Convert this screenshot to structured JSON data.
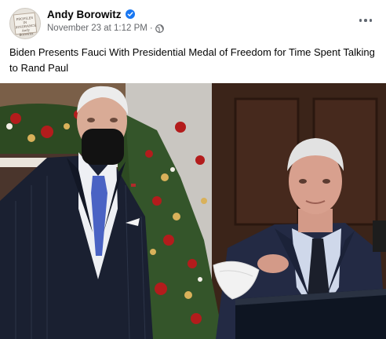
{
  "post": {
    "author": "Andy Borowitz",
    "timestamp": "November 23 at 1:12 PM",
    "separator": "·",
    "caption": "Biden Presents Fauci With Presidential Medal of Freedom for Time Spent Talking to Rand Paul",
    "avatar_text": [
      "PROFILES IN",
      "IGNORANCE",
      "Andy Borowitz"
    ]
  },
  "icons": {
    "verified": "verified-badge-icon",
    "audience": "globe-icon",
    "more": "more-options-icon"
  },
  "colors": {
    "brand": "#1877f2",
    "meta_text": "#65676b"
  }
}
